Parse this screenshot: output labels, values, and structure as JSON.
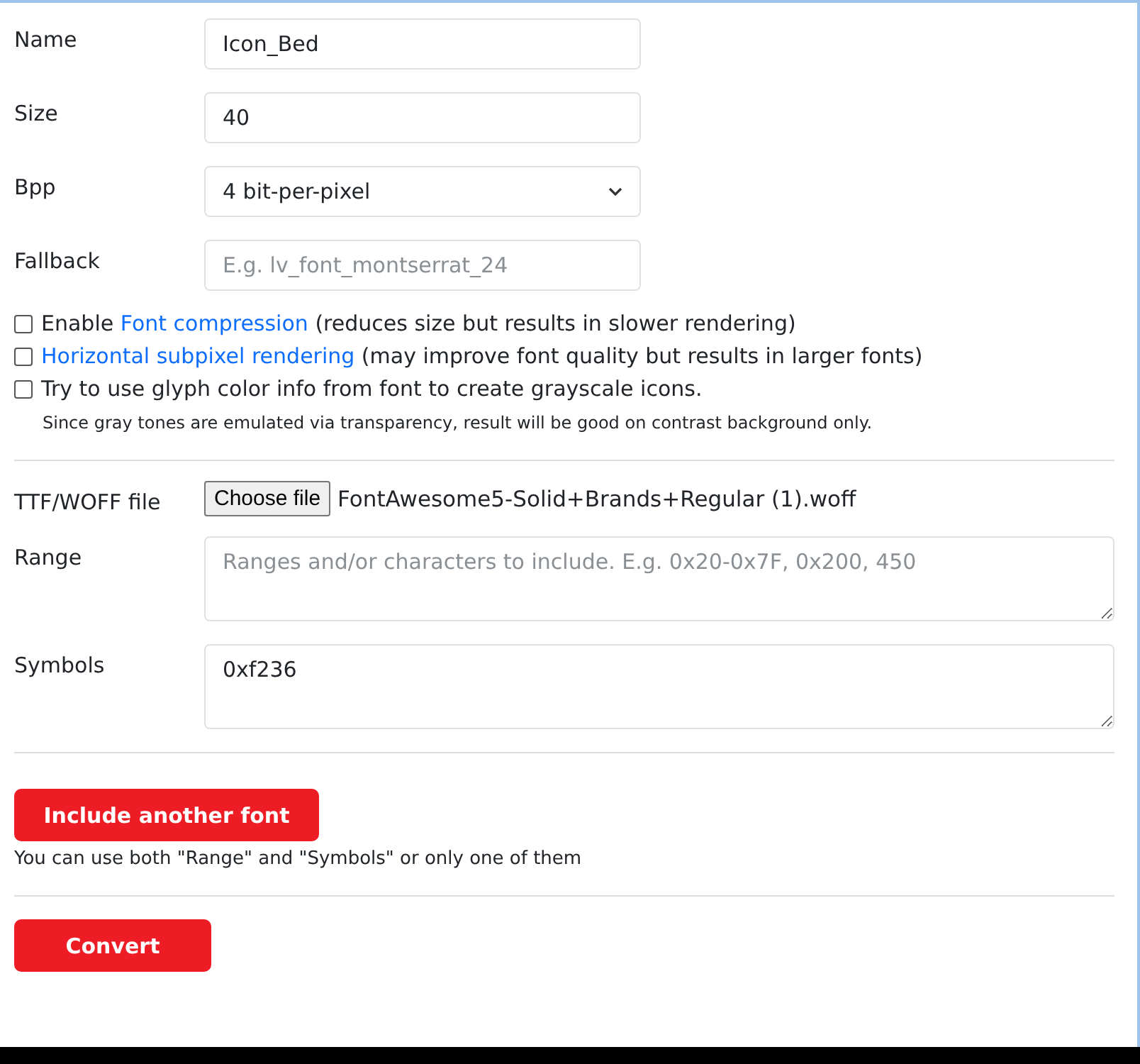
{
  "fields": [
    {
      "label": "Name",
      "kind": "text",
      "value": "Icon_Bed"
    },
    {
      "label": "Size",
      "kind": "text",
      "value": "40"
    },
    {
      "label": "Bpp",
      "kind": "select",
      "value": "4 bit-per-pixel"
    },
    {
      "label": "Fallback",
      "kind": "text",
      "placeholder": "E.g. lv_font_montserrat_24"
    }
  ],
  "options": [
    {
      "checked": false,
      "parts": [
        {
          "kind": "plain",
          "text": "Enable "
        },
        {
          "kind": "link",
          "text": "Font compression"
        },
        {
          "kind": "plain",
          "text": " (reduces size but results in slower rendering)"
        }
      ]
    },
    {
      "checked": false,
      "parts": [
        {
          "kind": "link",
          "text": "Horizontal subpixel rendering"
        },
        {
          "kind": "plain",
          "text": " (may improve font quality but results in larger fonts)"
        }
      ]
    },
    {
      "checked": false,
      "parts": [
        {
          "kind": "plain",
          "text": "Try to use glyph color info from font to create grayscale icons."
        }
      ]
    }
  ],
  "options_note": "Since gray tones are emulated via transparency, result will be good on contrast background only.",
  "font_file": {
    "label": "TTF/WOFF file",
    "button": "Choose file",
    "file_name": "FontAwesome5-Solid+Brands+Regular (1).woff"
  },
  "range": {
    "label": "Range",
    "placeholder": "Ranges and/or characters to include. E.g. 0x20-0x7F, 0x200, 450"
  },
  "symbols": {
    "label": "Symbols",
    "value": "0xf236"
  },
  "include_button": "Include another font",
  "include_note": "You can use both \"Range\" and \"Symbols\" or only one of them",
  "convert_button": "Convert"
}
